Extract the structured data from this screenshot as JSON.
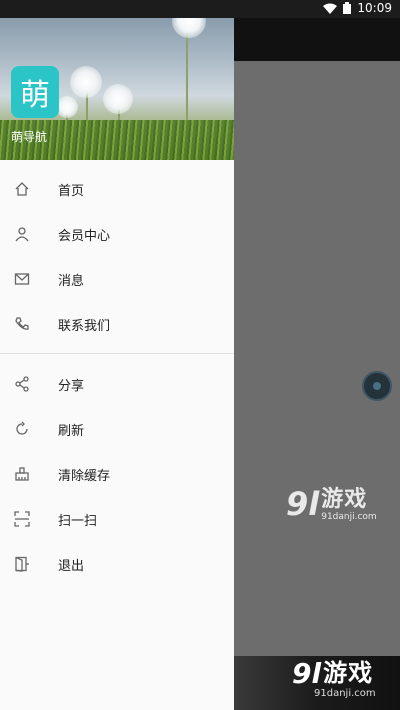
{
  "status_bar": {
    "time": "10:09"
  },
  "drawer": {
    "logo_char": "萌",
    "app_name": "萌导航",
    "menu_primary": [
      {
        "label": "首页",
        "icon": "home-icon"
      },
      {
        "label": "会员中心",
        "icon": "user-icon"
      },
      {
        "label": "消息",
        "icon": "mail-icon"
      },
      {
        "label": "联系我们",
        "icon": "phone-icon"
      }
    ],
    "menu_secondary": [
      {
        "label": "分享",
        "icon": "share-icon"
      },
      {
        "label": "刷新",
        "icon": "refresh-icon"
      },
      {
        "label": "清除缓存",
        "icon": "broom-icon"
      },
      {
        "label": "扫一扫",
        "icon": "scan-icon"
      },
      {
        "label": "退出",
        "icon": "exit-icon"
      }
    ]
  },
  "watermark": {
    "logo_num": "9l",
    "logo_text": "游戏",
    "site": "91danji.com"
  },
  "colors": {
    "logo_bg": "#2bc5c8",
    "icon_gray": "#666666"
  }
}
